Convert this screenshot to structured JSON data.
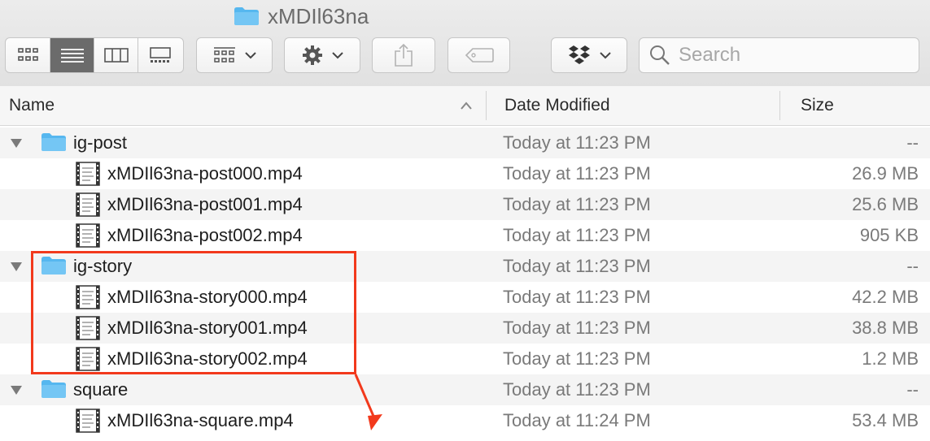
{
  "window": {
    "title": "xMDIl63na"
  },
  "toolbar": {
    "view_modes": [
      "icon-view",
      "list-view",
      "column-view",
      "gallery-view"
    ],
    "active_view": "list-view",
    "arrange_icon": "group-grid-icon",
    "action_icon": "gear-icon",
    "share_icon": "share-icon",
    "tag_icon": "tag-icon",
    "dropbox_icon": "dropbox-icon",
    "search": {
      "placeholder": "Search",
      "value": ""
    }
  },
  "columns": {
    "name": "Name",
    "date": "Date Modified",
    "size": "Size"
  },
  "sort": {
    "column": "Name",
    "direction": "ascending"
  },
  "rows": [
    {
      "type": "folder",
      "name": "ig-post",
      "date": "Today at 11:23 PM",
      "size": "--"
    },
    {
      "type": "file",
      "name": "xMDIl63na-post000.mp4",
      "date": "Today at 11:23 PM",
      "size": "26.9 MB"
    },
    {
      "type": "file",
      "name": "xMDIl63na-post001.mp4",
      "date": "Today at 11:23 PM",
      "size": "25.6 MB"
    },
    {
      "type": "file",
      "name": "xMDIl63na-post002.mp4",
      "date": "Today at 11:23 PM",
      "size": "905 KB"
    },
    {
      "type": "folder",
      "name": "ig-story",
      "date": "Today at 11:23 PM",
      "size": "--"
    },
    {
      "type": "file",
      "name": "xMDIl63na-story000.mp4",
      "date": "Today at 11:23 PM",
      "size": "42.2 MB"
    },
    {
      "type": "file",
      "name": "xMDIl63na-story001.mp4",
      "date": "Today at 11:23 PM",
      "size": "38.8 MB"
    },
    {
      "type": "file",
      "name": "xMDIl63na-story002.mp4",
      "date": "Today at 11:23 PM",
      "size": "1.2 MB"
    },
    {
      "type": "folder",
      "name": "square",
      "date": "Today at 11:23 PM",
      "size": "--"
    },
    {
      "type": "file",
      "name": "xMDIl63na-square.mp4",
      "date": "Today at 11:24 PM",
      "size": "53.4 MB"
    }
  ],
  "annotation": {
    "color": "#f2391c"
  }
}
